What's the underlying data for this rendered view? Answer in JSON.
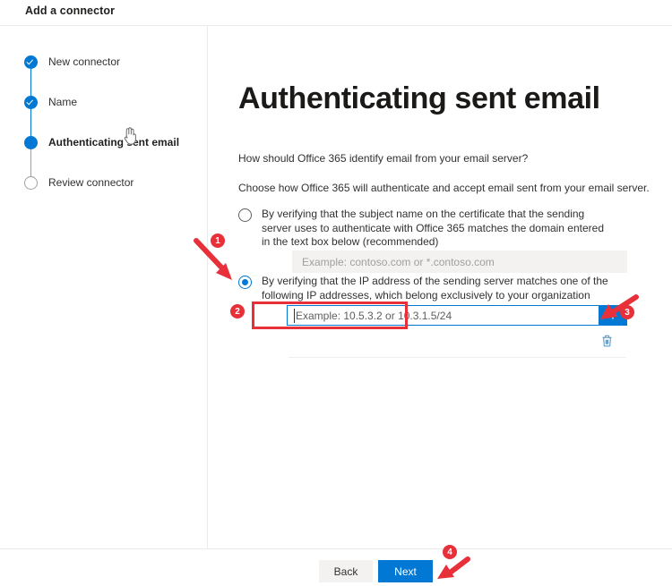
{
  "window": {
    "title": "Add a connector"
  },
  "stepper": {
    "steps": [
      {
        "label": "New connector",
        "state": "done"
      },
      {
        "label": "Name",
        "state": "done"
      },
      {
        "label": "Authenticating sent email",
        "state": "current"
      },
      {
        "label": "Review connector",
        "state": "todo"
      }
    ]
  },
  "main": {
    "heading": "Authenticating sent email",
    "question": "How should Office 365 identify email from your email server?",
    "instruction": "Choose how Office 365 will authenticate and accept email sent from your email server.",
    "options": [
      {
        "label": "By verifying that the subject name on the certificate that the sending server uses to authenticate with Office 365 matches the domain entered in the text box below (recommended)",
        "selected": false,
        "input_placeholder": "Example: contoso.com or *.contoso.com",
        "input_value": ""
      },
      {
        "label": "By verifying that the IP address of the sending server matches one of the following IP addresses, which belong exclusively to your organization",
        "selected": true,
        "input_placeholder": "Example: 10.5.3.2 or 10.3.1.5/24",
        "input_value": ""
      }
    ],
    "add_button_icon": "plus-icon",
    "delete_button_icon": "trash-icon"
  },
  "footer": {
    "back_label": "Back",
    "next_label": "Next"
  },
  "annotations": {
    "markers": [
      {
        "id": "1",
        "label": "1"
      },
      {
        "id": "2",
        "label": "2"
      },
      {
        "id": "3",
        "label": "3"
      },
      {
        "id": "4",
        "label": "4"
      }
    ],
    "accent_color": "#e8303a"
  },
  "colors": {
    "brand_blue": "#0078d4",
    "annotation_red": "#e8303a",
    "divider": "#edebe9",
    "disabled_field": "#f3f2f1"
  }
}
